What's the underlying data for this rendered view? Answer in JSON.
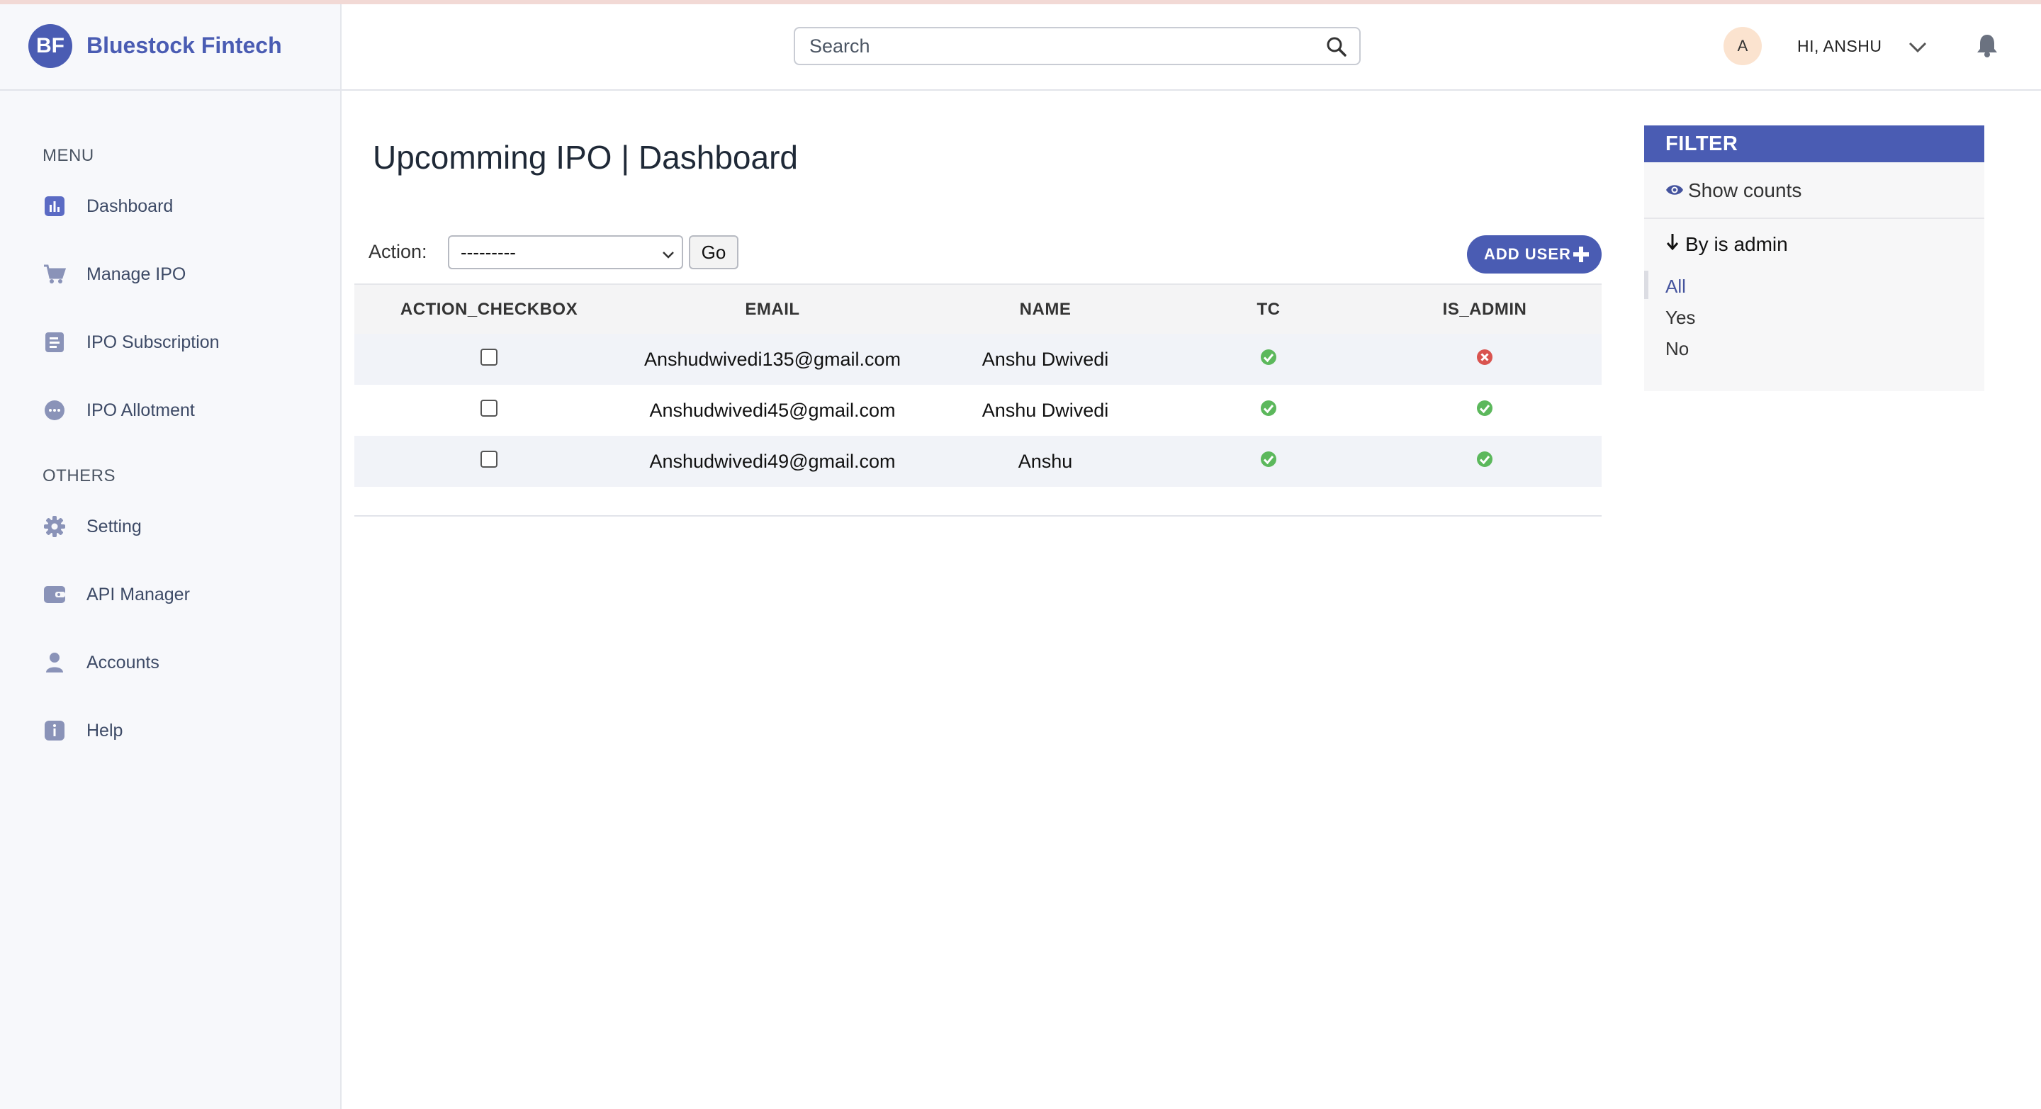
{
  "brand": {
    "logo_text": "BF",
    "name": "Bluestock Fintech"
  },
  "sidebar": {
    "menu_label": "MENU",
    "others_label": "OTHERS",
    "menu_items": [
      {
        "label": "Dashboard",
        "icon": "bar-chart-icon"
      },
      {
        "label": "Manage IPO",
        "icon": "cart-icon"
      },
      {
        "label": "IPO Subscription",
        "icon": "document-icon"
      },
      {
        "label": "IPO Allotment",
        "icon": "chat-icon"
      }
    ],
    "other_items": [
      {
        "label": "Setting",
        "icon": "gear-icon"
      },
      {
        "label": "API Manager",
        "icon": "api-card-icon"
      },
      {
        "label": "Accounts",
        "icon": "user-icon"
      },
      {
        "label": "Help",
        "icon": "info-icon"
      }
    ]
  },
  "header": {
    "search_placeholder": "Search",
    "avatar_letter": "A",
    "greeting": "HI, ANSHU"
  },
  "main": {
    "title": "Upcomming IPO | Dashboard",
    "action_label": "Action:",
    "action_selected": "---------",
    "go_label": "Go",
    "add_user_label": "ADD USER",
    "columns": [
      "ACTION_CHECKBOX",
      "EMAIL",
      "NAME",
      "TC",
      "IS_ADMIN"
    ],
    "rows": [
      {
        "email": "Anshudwivedi135@gmail.com",
        "name": "Anshu Dwivedi",
        "tc": true,
        "is_admin": false
      },
      {
        "email": "Anshudwivedi45@gmail.com",
        "name": "Anshu Dwivedi",
        "tc": true,
        "is_admin": true
      },
      {
        "email": "Anshudwivedi49@gmail.com",
        "name": "Anshu",
        "tc": true,
        "is_admin": true
      }
    ]
  },
  "filter": {
    "title": "FILTER",
    "show_counts": "Show counts",
    "by_label": "By is admin",
    "options": [
      "All",
      "Yes",
      "No"
    ],
    "selected": "All"
  },
  "colors": {
    "brand": "#4a5cb3",
    "sidebar_bg": "#f7f8fb",
    "yes": "#5cb85c",
    "no": "#d9534f"
  }
}
